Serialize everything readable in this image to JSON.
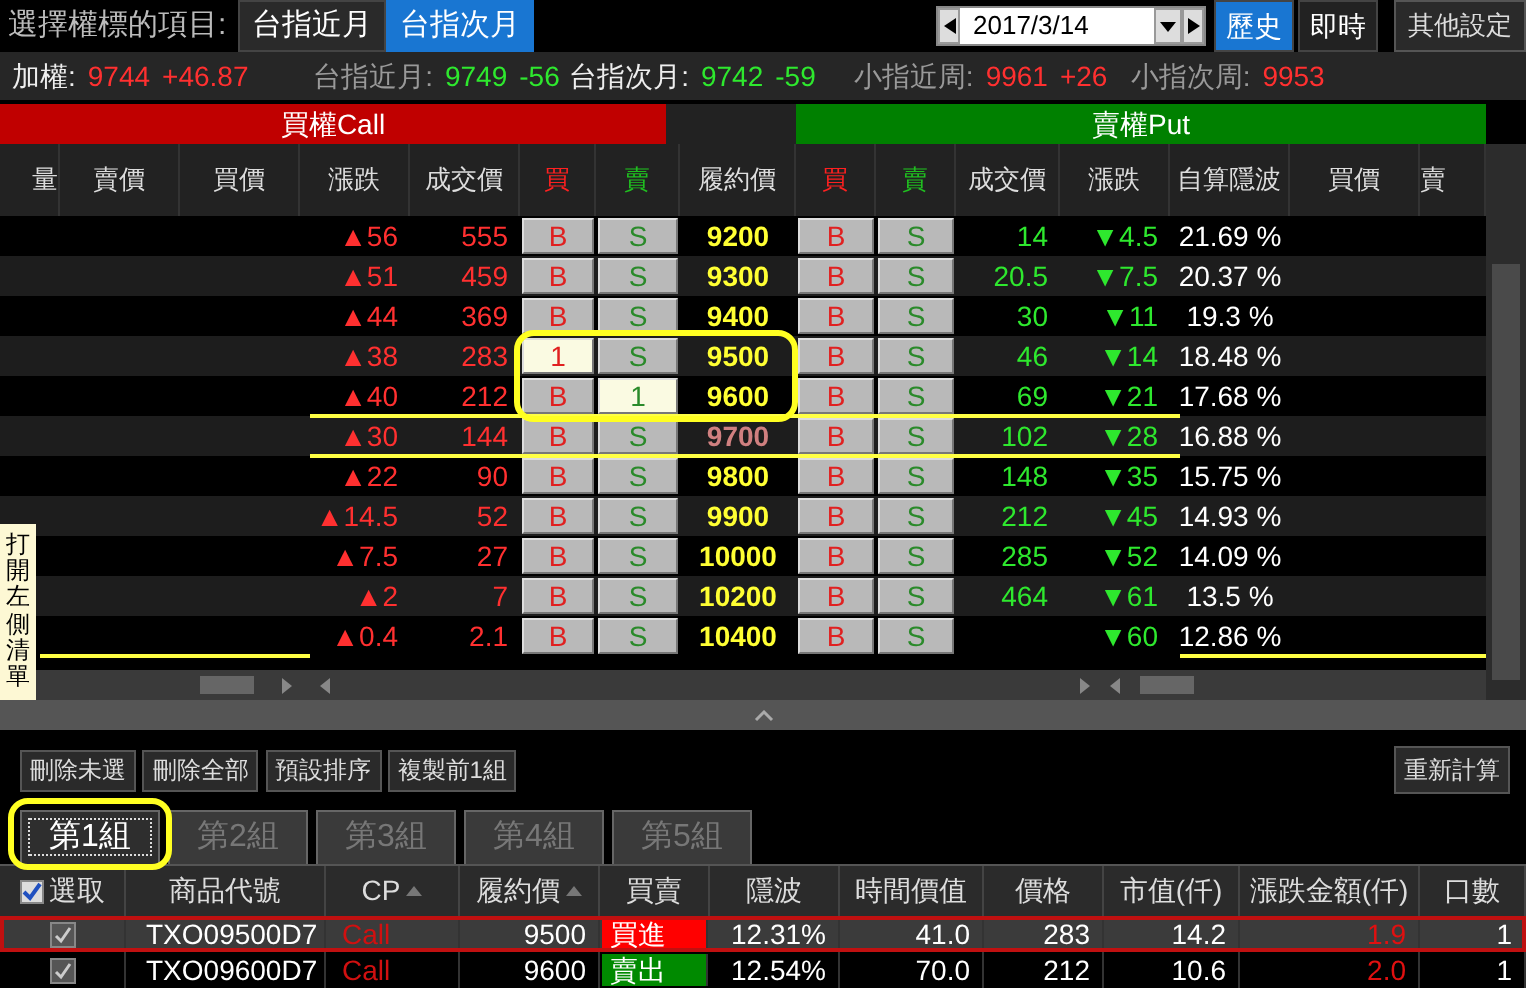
{
  "header": {
    "label": "選擇權標的項目:",
    "tabs": [
      {
        "label": "台指近月",
        "selected": false
      },
      {
        "label": "台指次月",
        "selected": true
      }
    ],
    "date": "2017/3/14",
    "mode_tabs": [
      {
        "label": "歷史",
        "selected": true
      },
      {
        "label": "即時",
        "selected": false
      }
    ],
    "settings_button": "其他設定"
  },
  "quotes": [
    {
      "name": "加權:",
      "price": "9744",
      "change": "+46.87",
      "color": "#ff3030",
      "emphasis": true
    },
    {
      "name": "台指近月:",
      "price": "9749",
      "change": "-56",
      "color": "#2ee82e",
      "emphasis": false
    },
    {
      "name": "台指次月:",
      "price": "9742",
      "change": "-59",
      "color": "#2ee82e",
      "emphasis": true
    },
    {
      "name": "小指近周:",
      "price": "9961",
      "change": "+26",
      "color": "#ff3030",
      "emphasis": false
    },
    {
      "name": "小指次周:",
      "price": "9953",
      "color": "#ff3030",
      "emphasis": false
    }
  ],
  "sections": [
    {
      "label": "買權Call",
      "kind": "call"
    },
    {
      "label": "賣權Put",
      "kind": "put"
    }
  ],
  "columns": [
    {
      "label": "量",
      "kind": "plain"
    },
    {
      "label": "賣價",
      "kind": "plain"
    },
    {
      "label": "買價",
      "kind": "plain"
    },
    {
      "label": "漲跌",
      "kind": "plain"
    },
    {
      "label": "成交價",
      "kind": "plain"
    },
    {
      "label": "買",
      "kind": "buy"
    },
    {
      "label": "賣",
      "kind": "sell"
    },
    {
      "label": "履約價",
      "kind": "plain"
    },
    {
      "label": "買",
      "kind": "buy"
    },
    {
      "label": "賣",
      "kind": "sell"
    },
    {
      "label": "成交價",
      "kind": "plain"
    },
    {
      "label": "漲跌",
      "kind": "plain"
    },
    {
      "label": "自算隱波",
      "kind": "plain"
    },
    {
      "label": "買價",
      "kind": "plain"
    },
    {
      "label": "賣",
      "kind": "plain"
    }
  ],
  "rows": [
    {
      "call_change": "▲56",
      "call_price": "555",
      "call_buy": {
        "label": "B",
        "selected": false
      },
      "call_sell": {
        "label": "S",
        "selected": false
      },
      "strike": "9200",
      "put_buy": {
        "label": "B",
        "selected": false
      },
      "put_sell": {
        "label": "S",
        "selected": false
      },
      "put_price": "14",
      "put_change": "▼4.5",
      "iv": "21.69 %",
      "atm": false,
      "circled": false,
      "boundary": false
    },
    {
      "call_change": "▲51",
      "call_price": "459",
      "call_buy": {
        "label": "B",
        "selected": false
      },
      "call_sell": {
        "label": "S",
        "selected": false
      },
      "strike": "9300",
      "put_buy": {
        "label": "B",
        "selected": false
      },
      "put_sell": {
        "label": "S",
        "selected": false
      },
      "put_price": "20.5",
      "put_change": "▼7.5",
      "iv": "20.37 %",
      "atm": false,
      "circled": false,
      "boundary": false
    },
    {
      "call_change": "▲44",
      "call_price": "369",
      "call_buy": {
        "label": "B",
        "selected": false
      },
      "call_sell": {
        "label": "S",
        "selected": false
      },
      "strike": "9400",
      "put_buy": {
        "label": "B",
        "selected": false
      },
      "put_sell": {
        "label": "S",
        "selected": false
      },
      "put_price": "30",
      "put_change": "▼11",
      "iv": "19.3 %",
      "atm": false,
      "circled": false,
      "boundary": false
    },
    {
      "call_change": "▲38",
      "call_price": "283",
      "call_buy": {
        "label": "1",
        "selected": true
      },
      "call_sell": {
        "label": "S",
        "selected": false
      },
      "strike": "9500",
      "put_buy": {
        "label": "B",
        "selected": false
      },
      "put_sell": {
        "label": "S",
        "selected": false
      },
      "put_price": "46",
      "put_change": "▼14",
      "iv": "18.48 %",
      "atm": false,
      "circled": true,
      "boundary": false
    },
    {
      "call_change": "▲40",
      "call_price": "212",
      "call_buy": {
        "label": "B",
        "selected": false
      },
      "call_sell": {
        "label": "1",
        "selected": true
      },
      "strike": "9600",
      "put_buy": {
        "label": "B",
        "selected": false
      },
      "put_sell": {
        "label": "S",
        "selected": false
      },
      "put_price": "69",
      "put_change": "▼21",
      "iv": "17.68 %",
      "atm": false,
      "circled": true,
      "boundary": false
    },
    {
      "call_change": "▲30",
      "call_price": "144",
      "call_buy": {
        "label": "B",
        "selected": false
      },
      "call_sell": {
        "label": "S",
        "selected": false
      },
      "strike": "9700",
      "put_buy": {
        "label": "B",
        "selected": false
      },
      "put_sell": {
        "label": "S",
        "selected": false
      },
      "put_price": "102",
      "put_change": "▼28",
      "iv": "16.88 %",
      "atm": true,
      "circled": false,
      "boundary": false
    },
    {
      "call_change": "▲22",
      "call_price": "90",
      "call_buy": {
        "label": "B",
        "selected": false
      },
      "call_sell": {
        "label": "S",
        "selected": false
      },
      "strike": "9800",
      "put_buy": {
        "label": "B",
        "selected": false
      },
      "put_sell": {
        "label": "S",
        "selected": false
      },
      "put_price": "148",
      "put_change": "▼35",
      "iv": "15.75 %",
      "atm": false,
      "circled": false,
      "boundary": false
    },
    {
      "call_change": "▲14.5",
      "call_price": "52",
      "call_buy": {
        "label": "B",
        "selected": false
      },
      "call_sell": {
        "label": "S",
        "selected": false
      },
      "strike": "9900",
      "put_buy": {
        "label": "B",
        "selected": false
      },
      "put_sell": {
        "label": "S",
        "selected": false
      },
      "put_price": "212",
      "put_change": "▼45",
      "iv": "14.93 %",
      "atm": false,
      "circled": false,
      "boundary": false
    },
    {
      "call_change": "▲7.5",
      "call_price": "27",
      "call_buy": {
        "label": "B",
        "selected": false
      },
      "call_sell": {
        "label": "S",
        "selected": false
      },
      "strike": "10000",
      "put_buy": {
        "label": "B",
        "selected": false
      },
      "put_sell": {
        "label": "S",
        "selected": false
      },
      "put_price": "285",
      "put_change": "▼52",
      "iv": "14.09 %",
      "atm": false,
      "circled": false,
      "boundary": false
    },
    {
      "call_change": "▲2",
      "call_price": "7",
      "call_buy": {
        "label": "B",
        "selected": false
      },
      "call_sell": {
        "label": "S",
        "selected": false
      },
      "strike": "10200",
      "put_buy": {
        "label": "B",
        "selected": false
      },
      "put_sell": {
        "label": "S",
        "selected": false
      },
      "put_price": "464",
      "put_change": "▼61",
      "iv": "13.5 %",
      "atm": false,
      "circled": false,
      "boundary": false
    },
    {
      "call_change": "▲0.4",
      "call_price": "2.1",
      "call_buy": {
        "label": "B",
        "selected": false
      },
      "call_sell": {
        "label": "S",
        "selected": false
      },
      "strike": "10400",
      "put_buy": {
        "label": "B",
        "selected": false
      },
      "put_sell": {
        "label": "S",
        "selected": false
      },
      "put_change": "▼60",
      "iv": "12.86 %",
      "atm": false,
      "circled": false,
      "boundary": true
    }
  ],
  "side_tab": "打開左側清單",
  "toolbar": {
    "buttons": [
      "刪除未選",
      "刪除全部",
      "預設排序",
      "複製前1組"
    ],
    "recalc_button": "重新計算"
  },
  "groups": [
    {
      "label": "第1組",
      "selected": true,
      "circled": true
    },
    {
      "label": "第2組",
      "selected": false,
      "circled": false
    },
    {
      "label": "第3組",
      "selected": false,
      "circled": false
    },
    {
      "label": "第4組",
      "selected": false,
      "circled": false
    },
    {
      "label": "第5組",
      "selected": false,
      "circled": false
    }
  ],
  "portfolio": {
    "columns": [
      {
        "label": "選取",
        "kind": "checkbox",
        "checked": true
      },
      {
        "label": "商品代號",
        "kind": "plain"
      },
      {
        "label": "CP",
        "kind": "sort"
      },
      {
        "label": "履約價",
        "kind": "sort"
      },
      {
        "label": "買賣",
        "kind": "plain"
      },
      {
        "label": "隱波",
        "kind": "plain"
      },
      {
        "label": "時間價值",
        "kind": "plain"
      },
      {
        "label": "價格",
        "kind": "plain"
      },
      {
        "label": "市值(仟)",
        "kind": "plain"
      },
      {
        "label": "漲跌金額(仟)",
        "kind": "plain"
      },
      {
        "label": "口數",
        "kind": "plain"
      }
    ],
    "rows": [
      {
        "checked": true,
        "selected": true,
        "code": "TXO09500D7",
        "cp": "Call",
        "strike": "9500",
        "side": "買進",
        "color": "#ff0000",
        "iv": "12.31%",
        "time_value": "41.0",
        "price": "283",
        "market_value": "14.2",
        "change_amount": "1.9",
        "lots": "1"
      },
      {
        "checked": true,
        "selected": false,
        "code": "TXO09600D7",
        "cp": "Call",
        "strike": "9600",
        "side": "賣出",
        "color": "#008a00",
        "iv": "12.54%",
        "time_value": "70.0",
        "price": "212",
        "market_value": "10.6",
        "change_amount": "2.0",
        "lots": "1"
      }
    ]
  }
}
